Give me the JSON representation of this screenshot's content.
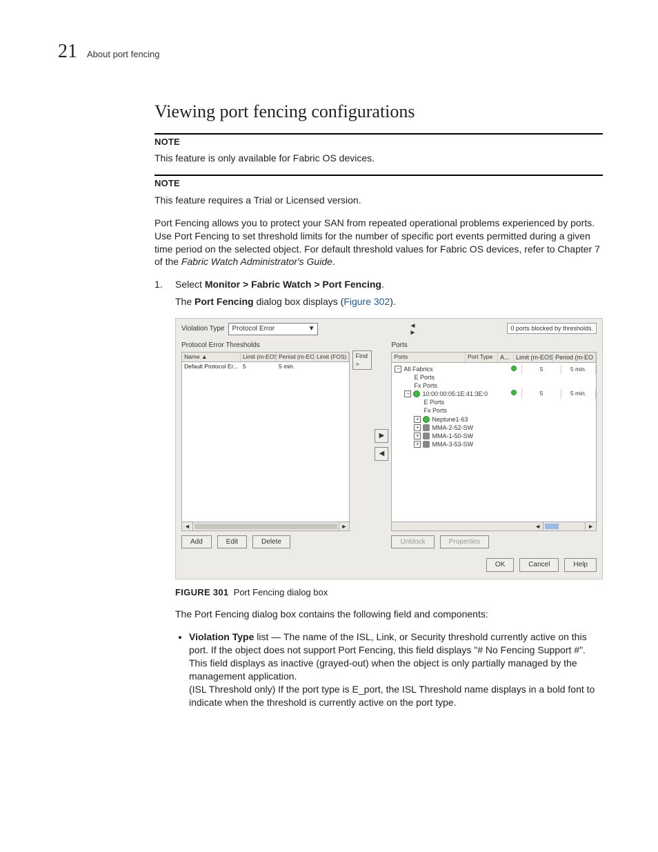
{
  "header": {
    "pageNumber": "21",
    "breadcrumb": "About port fencing"
  },
  "section": {
    "title": "Viewing port fencing configurations",
    "note1Label": "NOTE",
    "note1Text": "This feature is only available for Fabric OS devices.",
    "note2Label": "NOTE",
    "note2Text": "This feature requires a Trial or Licensed version.",
    "intro": "Port Fencing allows you to protect your SAN from repeated operational problems experienced by ports. Use Port Fencing to set threshold limits for the number of specific port events permitted during a given time period on the selected object. For default threshold values for Fabric OS devices, refer to Chapter 7 of the ",
    "introItalic": "Fabric Watch Administrator's Guide",
    "introEnd": ".",
    "step1Num": "1.",
    "step1a": "Select ",
    "step1b": "Monitor > Fabric Watch > Port Fencing",
    "step1c": ".",
    "step1_2a": "The ",
    "step1_2b": "Port Fencing",
    "step1_2c": " dialog box displays (",
    "step1_2link": "Figure 302",
    "step1_2d": ")."
  },
  "dialog": {
    "violationTypeLabel": "Violation Type",
    "violationTypeValue": "Protocol Error",
    "blockedText": "0 ports blocked by thresholds.",
    "leftTitle": "Protocol Error Thresholds",
    "rightTitle": "Ports",
    "leftCols": {
      "c1": "Name ▲",
      "c2": "Limit (m-EOS)",
      "c3": "Period (m-EOS)",
      "c4": "Limit (FOS)"
    },
    "leftRow": {
      "c1": "Default Protocol Er...",
      "c2": "5",
      "c3": "5 min.",
      "c4": ""
    },
    "findBtn": "Find >",
    "rightCols": {
      "c1": "Ports",
      "c2": "Port Type",
      "c3": "A...",
      "c4": "Limit (m-EOS)",
      "c5": "Period (m-EO"
    },
    "tree": {
      "r0": "All Fabrics",
      "r1": "E Ports",
      "r2": "Fx Ports",
      "r3": "10:00:00:05:1E:41:3E:0",
      "r4": "E Ports",
      "r5": "Fx Ports",
      "r6": "Neptune1-63",
      "r7": "MMA-2-52-SW",
      "r8": "MMA-1-50-SW",
      "r9": "MMA-3-53-SW"
    },
    "rightRow0": {
      "limit": "5",
      "period": "5 min."
    },
    "rightRow3": {
      "limit": "5",
      "period": "5 min."
    },
    "addBtn": "Add",
    "editBtn": "Edit",
    "deleteBtn": "Delete",
    "unblockBtn": "Unblock",
    "propsBtn": "Properties",
    "okBtn": "OK",
    "cancelBtn": "Cancel",
    "helpBtn": "Help"
  },
  "caption": {
    "label": "FIGURE 301",
    "text": "Port Fencing dialog box"
  },
  "after": {
    "p1": "The Port Fencing dialog box contains the following field and components:",
    "b1Lead": "Violation Type",
    "b1a": " list — The name of the ISL, Link, or Security threshold currently active on this port. If the object does not support Port Fencing, this field displays \"# No Fencing Support #\". This field displays as inactive (grayed-out) when the object is only partially managed by the management application.",
    "b1b": "(ISL Threshold only) If the port type is E_port, the ISL Threshold name displays in a bold font to indicate when the threshold is currently active on the port type."
  }
}
